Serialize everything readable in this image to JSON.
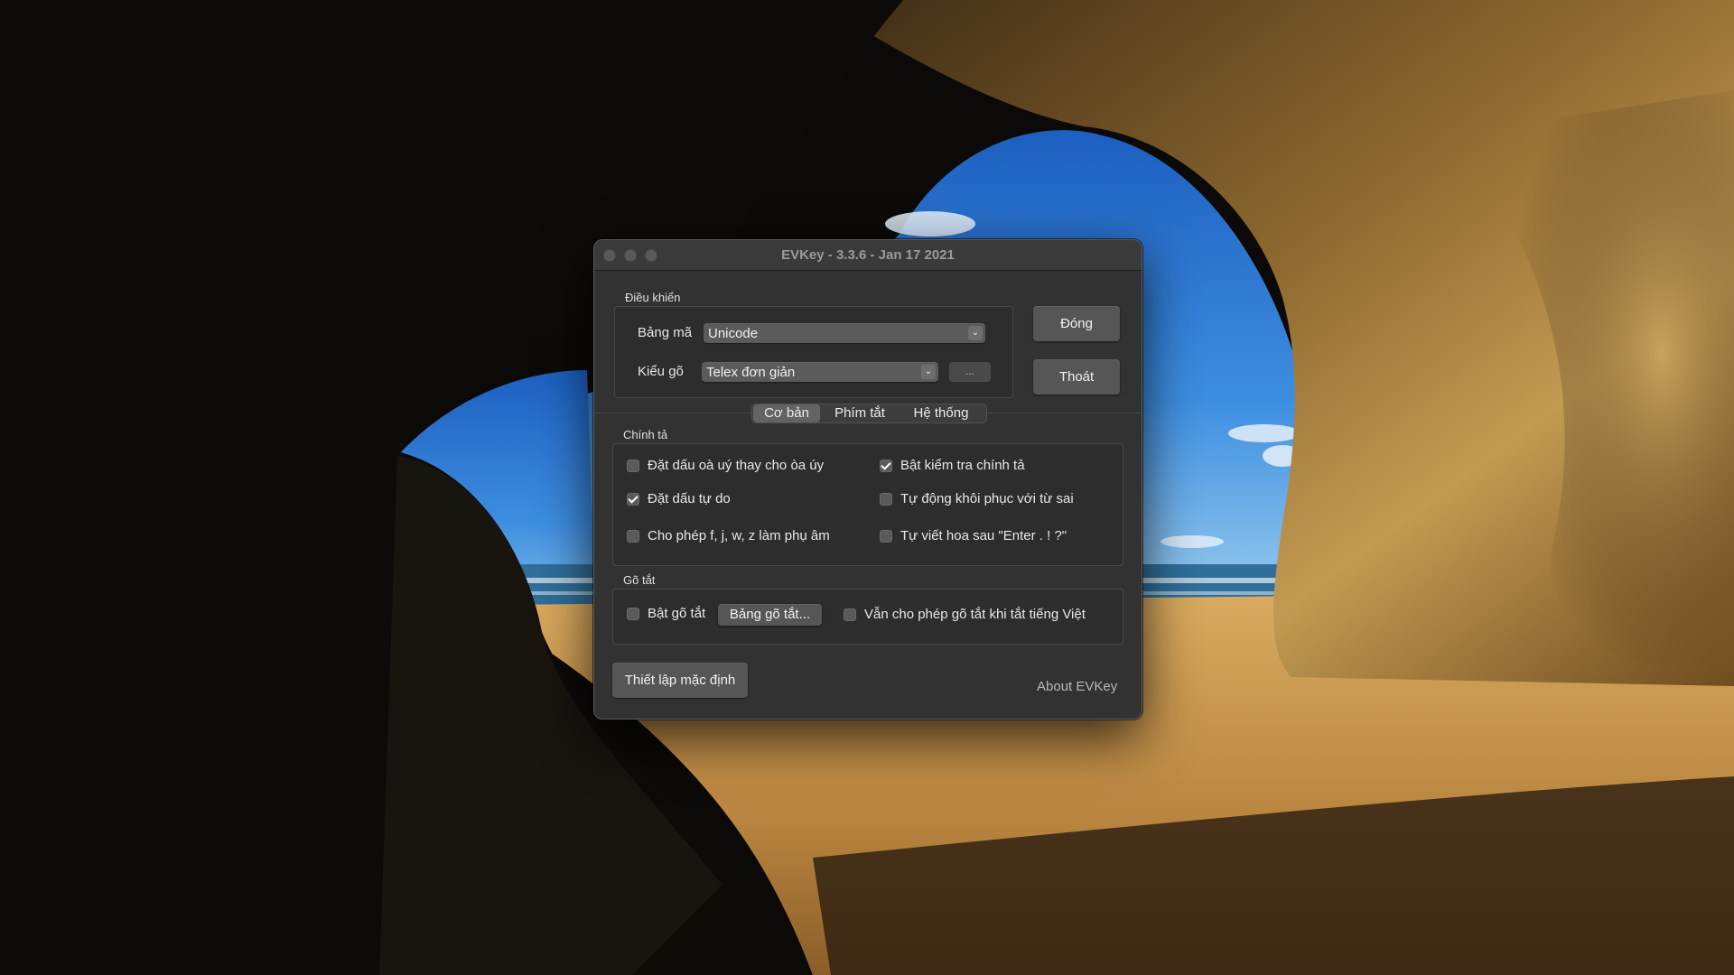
{
  "window": {
    "title": "EVKey - 3.3.6 - Jan 17 2021"
  },
  "control": {
    "section_title": "Điều khiển",
    "charset_label": "Bảng mã",
    "charset_value": "Unicode",
    "input_method_label": "Kiểu gõ",
    "input_method_value": "Telex đơn giản",
    "more_button": "...",
    "close_button": "Đóng",
    "quit_button": "Thoát"
  },
  "tabs": [
    {
      "label": "Cơ bản",
      "active": true
    },
    {
      "label": "Phím tắt",
      "active": false
    },
    {
      "label": "Hệ thống",
      "active": false
    }
  ],
  "spelling": {
    "section_title": "Chính tả",
    "options": [
      {
        "label": "Đặt dấu oà uý thay cho òa úy",
        "checked": false
      },
      {
        "label": "Bật kiểm tra chính tả",
        "checked": true
      },
      {
        "label": "Đặt dấu tự do",
        "checked": true
      },
      {
        "label": "Tự động khôi phục với từ sai",
        "checked": false
      },
      {
        "label": "Cho phép f, j, w, z làm phụ âm",
        "checked": false
      },
      {
        "label": "Tự viết hoa sau \"Enter . ! ?\"",
        "checked": false
      }
    ]
  },
  "shortcut": {
    "section_title": "Gõ tắt",
    "enable_label": "Bật gõ tắt",
    "enable_checked": false,
    "table_button": "Bảng gõ tắt...",
    "allow_label": "Vẫn cho phép gõ tắt khi tắt tiếng Việt",
    "allow_checked": false
  },
  "footer": {
    "reset_button": "Thiết lập mặc định",
    "about_link": "About EVKey"
  },
  "colors": {
    "window_bg": "#323232",
    "titlebar_bg": "#3a3a3a",
    "button_bg": "#565656",
    "active_tab_bg": "#636363"
  },
  "icons": {
    "popup_arrow": "chevron-updown-icon",
    "checkmark": "checkmark-icon"
  }
}
